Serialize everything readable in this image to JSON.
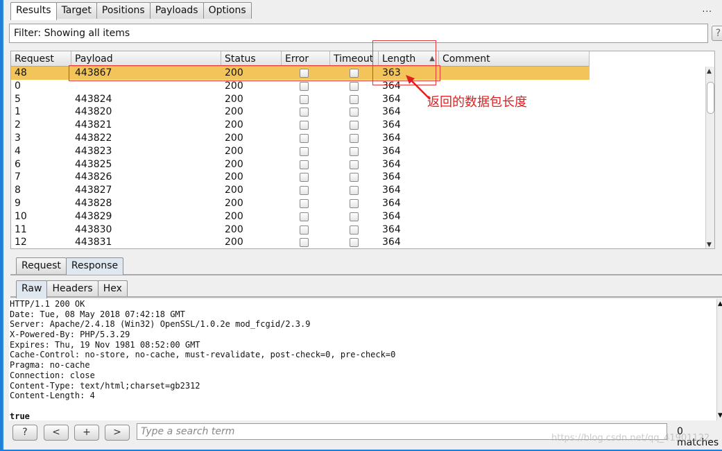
{
  "top_tabs": [
    "Results",
    "Target",
    "Positions",
    "Payloads",
    "Options"
  ],
  "more": "...",
  "filter": "Filter: Showing all items",
  "help": "?",
  "columns": [
    "Request",
    "Payload",
    "Status",
    "Error",
    "Timeout",
    "Length",
    "Comment"
  ],
  "rows": [
    {
      "request": "48",
      "payload": "443867",
      "status": "200",
      "length": "363",
      "selected": true
    },
    {
      "request": "0",
      "payload": "",
      "status": "200",
      "length": "364"
    },
    {
      "request": "5",
      "payload": "443824",
      "status": "200",
      "length": "364"
    },
    {
      "request": "1",
      "payload": "443820",
      "status": "200",
      "length": "364"
    },
    {
      "request": "2",
      "payload": "443821",
      "status": "200",
      "length": "364"
    },
    {
      "request": "3",
      "payload": "443822",
      "status": "200",
      "length": "364"
    },
    {
      "request": "4",
      "payload": "443823",
      "status": "200",
      "length": "364"
    },
    {
      "request": "6",
      "payload": "443825",
      "status": "200",
      "length": "364"
    },
    {
      "request": "7",
      "payload": "443826",
      "status": "200",
      "length": "364"
    },
    {
      "request": "8",
      "payload": "443827",
      "status": "200",
      "length": "364"
    },
    {
      "request": "9",
      "payload": "443828",
      "status": "200",
      "length": "364"
    },
    {
      "request": "10",
      "payload": "443829",
      "status": "200",
      "length": "364"
    },
    {
      "request": "11",
      "payload": "443830",
      "status": "200",
      "length": "364"
    },
    {
      "request": "12",
      "payload": "443831",
      "status": "200",
      "length": "364"
    }
  ],
  "annotation": "返回的数据包长度",
  "req_resp_tabs": [
    "Request",
    "Response"
  ],
  "view_tabs": [
    "Raw",
    "Headers",
    "Hex"
  ],
  "response_lines": [
    "HTTP/1.1 200 OK",
    "Date: Tue, 08 May 2018 07:42:18 GMT",
    "Server: Apache/2.4.18 (Win32) OpenSSL/1.0.2e mod_fcgid/2.3.9",
    "X-Powered-By: PHP/5.3.29",
    "Expires: Thu, 19 Nov 1981 08:52:00 GMT",
    "Cache-Control: no-store, no-cache, must-revalidate, post-check=0, pre-check=0",
    "Pragma: no-cache",
    "Connection: close",
    "Content-Type: text/html;charset=gb2312",
    "Content-Length: 4",
    ""
  ],
  "response_body": "true",
  "bottom_buttons": [
    "?",
    "<",
    "+",
    ">"
  ],
  "search_placeholder": "Type a search term",
  "matches": "0 matches",
  "watermark": "https://blog.csdn.net/qq_41901122",
  "colors": {
    "selected_row": "#f2c45a",
    "annotation": "#e02020",
    "window_border": "#2a8bdc"
  },
  "icons": {
    "sort": "sort-ascending-icon",
    "scroll_up": "scroll-up-icon",
    "scroll_down": "scroll-down-icon"
  }
}
